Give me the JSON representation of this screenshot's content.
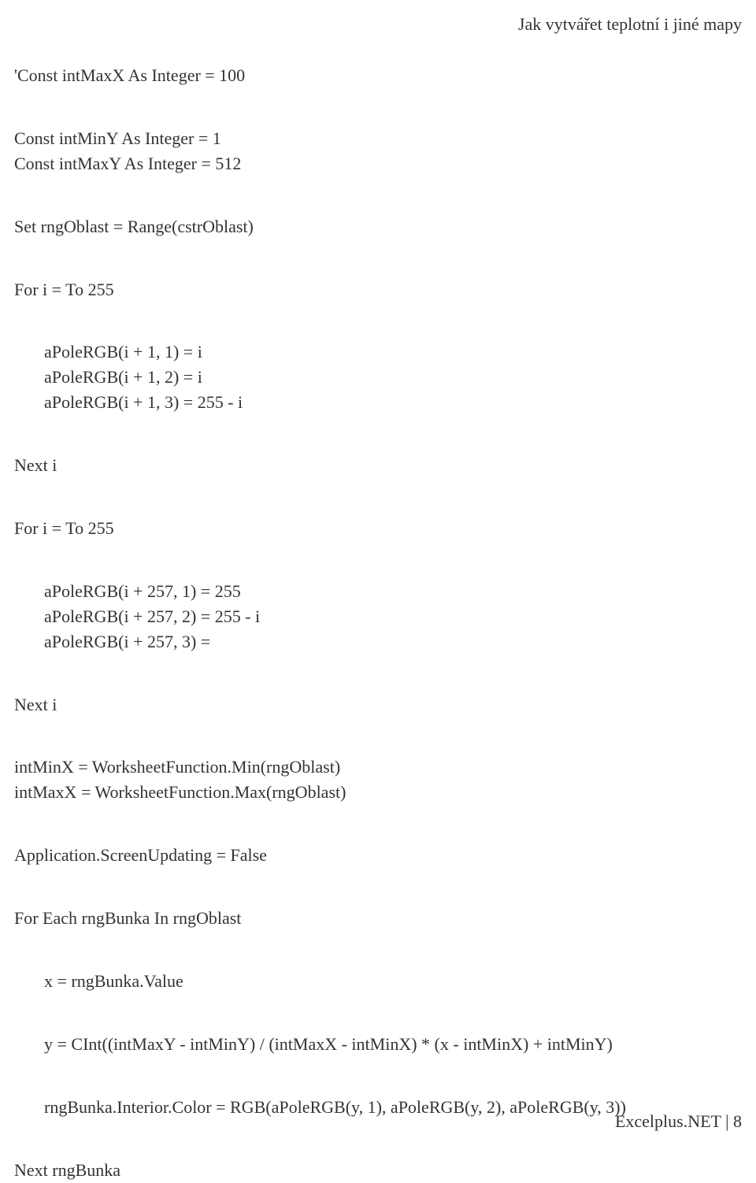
{
  "header": {
    "title": "Jak vytvářet teplotní i jiné mapy"
  },
  "code": {
    "l1": "'Const intMaxX As Integer = 100",
    "l2": "Const intMinY As Integer = 1",
    "l3": "Const intMaxY As Integer = 512",
    "l4": "Set rngOblast = Range(cstrOblast)",
    "l5": "For i =  To 255",
    "l6": "aPoleRGB(i + 1, 1) = i",
    "l7": "aPoleRGB(i + 1, 2) = i",
    "l8": "aPoleRGB(i + 1, 3) = 255 - i",
    "l9": "Next i",
    "l10": "For i =  To 255",
    "l11": "aPoleRGB(i + 257, 1) = 255",
    "l12": "aPoleRGB(i + 257, 2) = 255 - i",
    "l13": "aPoleRGB(i + 257, 3) =",
    "l14": "Next i",
    "l15": "intMinX = WorksheetFunction.Min(rngOblast)",
    "l16": "intMaxX = WorksheetFunction.Max(rngOblast)",
    "l17": "Application.ScreenUpdating = False",
    "l18": "For Each rngBunka In rngOblast",
    "l19": "x = rngBunka.Value",
    "l20": "y = CInt((intMaxY - intMinY) / (intMaxX - intMinX) * (x - intMinX) + intMinY)",
    "l21": "rngBunka.Interior.Color = RGB(aPoleRGB(y, 1), aPoleRGB(y, 2), aPoleRGB(y, 3))",
    "l22": "Next rngBunka"
  },
  "footer": {
    "text": "Excelplus.NET | 8"
  }
}
